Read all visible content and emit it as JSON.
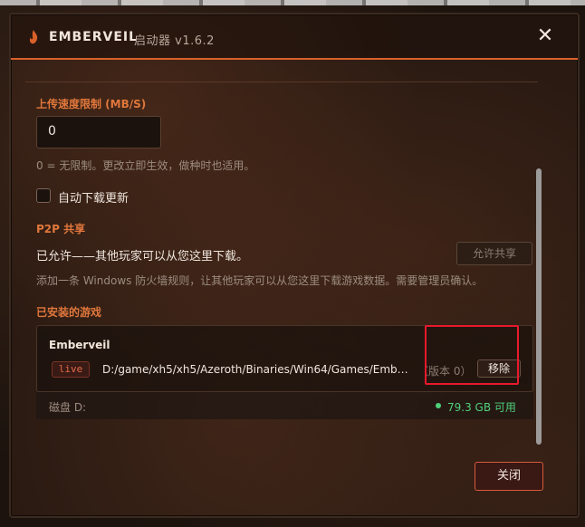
{
  "header": {
    "app_name": "EMBERVEIL",
    "subtitle": "启动器 v1.6.2",
    "logo_icon": "flame-icon",
    "close_icon": "close-icon"
  },
  "upload": {
    "label": "上传速度限制 (MB/S)",
    "value": "0",
    "hint": "0 = 无限制。更改立即生效，做种时也适用。"
  },
  "auto_update": {
    "label": "自动下载更新",
    "checked": false
  },
  "p2p": {
    "section_title": "P2P 共享",
    "status": "已允许——其他玩家可以从您这里下载。",
    "button": "允许共享",
    "hint": "添加一条 Windows 防火墙规则，让其他玩家可以从您这里下载游戏数据。需要管理员确认。"
  },
  "installed": {
    "section_title": "已安装的游戏",
    "game": {
      "title": "Emberveil",
      "badge": "live",
      "path": "D:/game/xh5/xh5/Azeroth/Binaries/Win64/Games/Embe…",
      "version": "（版本 0）",
      "remove_button": "移除"
    },
    "disk": {
      "label": "磁盘 D:",
      "free": "79.3 GB 可用",
      "status_color": "#4fd07a"
    }
  },
  "footer": {
    "close_button": "关闭"
  },
  "colors": {
    "accent": "#e0773c",
    "highlight": "#e8192c"
  }
}
